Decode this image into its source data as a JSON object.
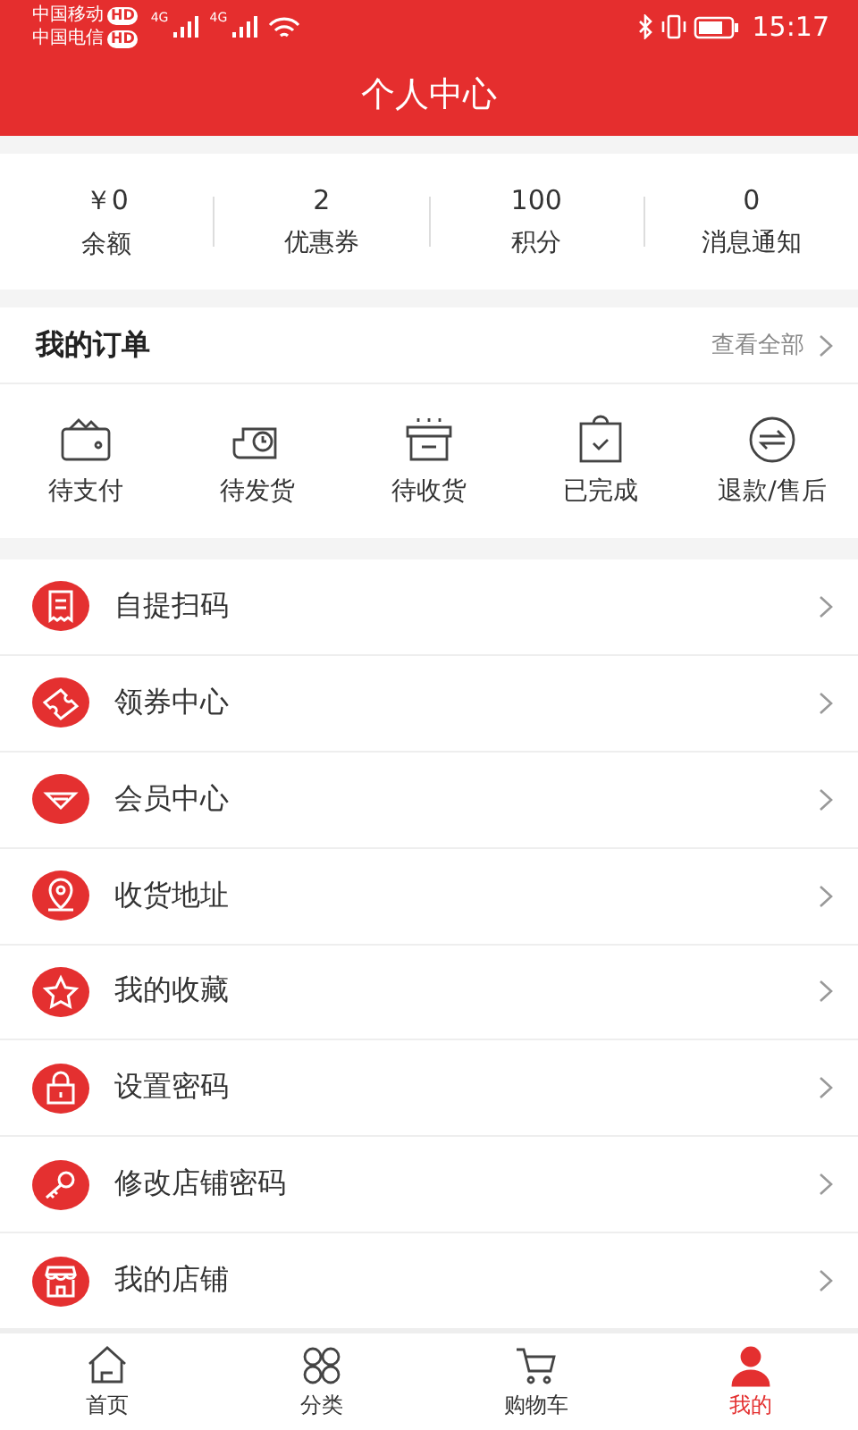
{
  "status_bar": {
    "carriers": [
      {
        "name": "中国移动",
        "badge": "HD"
      },
      {
        "name": "中国电信",
        "badge": "HD"
      }
    ],
    "network": [
      "4G",
      "4G"
    ],
    "time": "15:17"
  },
  "header": {
    "title": "个人中心"
  },
  "stats": [
    {
      "value": "￥0",
      "label": "余额"
    },
    {
      "value": "2",
      "label": "优惠券"
    },
    {
      "value": "100",
      "label": "积分"
    },
    {
      "value": "0",
      "label": "消息通知"
    }
  ],
  "orders": {
    "title": "我的订单",
    "view_all": "查看全部",
    "items": [
      {
        "kind": "wallet",
        "label": "待支付"
      },
      {
        "kind": "truck",
        "label": "待发货"
      },
      {
        "kind": "box",
        "label": "待收货"
      },
      {
        "kind": "clipboard",
        "label": "已完成"
      },
      {
        "kind": "exchange",
        "label": "退款/售后"
      }
    ]
  },
  "menu": [
    {
      "kind": "receipt",
      "label": "自提扫码"
    },
    {
      "kind": "ticket",
      "label": "领券中心"
    },
    {
      "kind": "diamond",
      "label": "会员中心"
    },
    {
      "kind": "pin",
      "label": "收货地址"
    },
    {
      "kind": "star",
      "label": "我的收藏"
    },
    {
      "kind": "lock",
      "label": "设置密码"
    },
    {
      "kind": "key",
      "label": "修改店铺密码"
    },
    {
      "kind": "shop",
      "label": "我的店铺"
    }
  ],
  "tab_bar": [
    {
      "kind": "home",
      "label": "首页",
      "selected": false
    },
    {
      "kind": "grid",
      "label": "分类",
      "selected": false
    },
    {
      "kind": "cart",
      "label": "购物车",
      "selected": false
    },
    {
      "kind": "person",
      "label": "我的",
      "selected": true
    }
  ]
}
